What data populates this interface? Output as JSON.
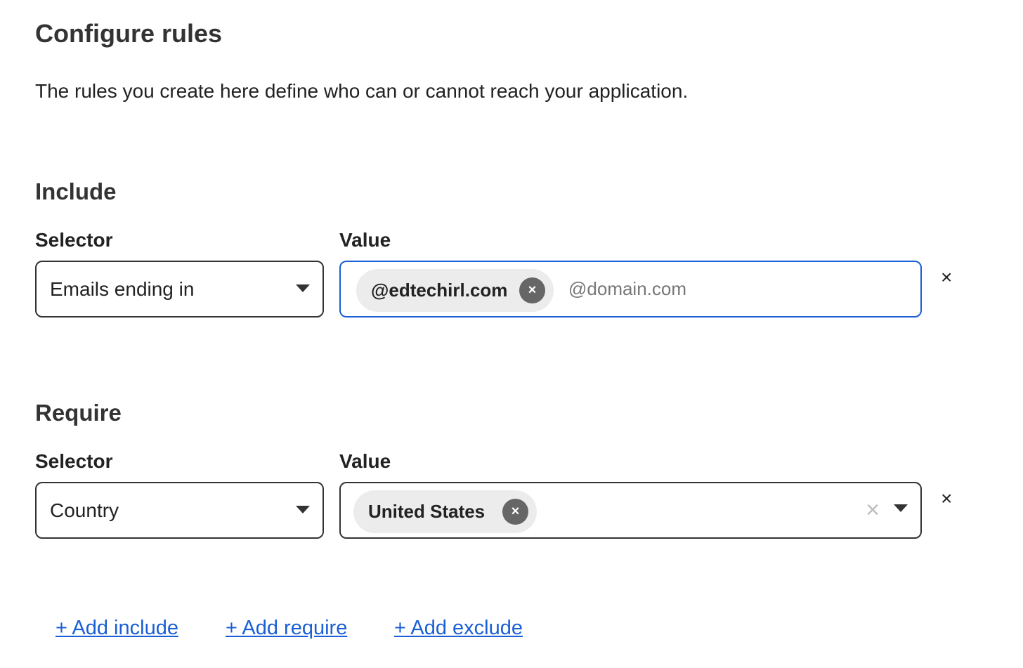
{
  "header": {
    "title": "Configure rules",
    "description": "The rules you create here define who can or cannot reach your application."
  },
  "include": {
    "section_title": "Include",
    "selector_label": "Selector",
    "value_label": "Value",
    "selector_value": "Emails ending in",
    "chips": [
      "@edtechirl.com"
    ],
    "input_placeholder": "@domain.com",
    "input_value": "",
    "chip_remove_icon": "×",
    "row_remove_icon": "×"
  },
  "require": {
    "section_title": "Require",
    "selector_label": "Selector",
    "value_label": "Value",
    "selector_value": "Country",
    "chips": [
      "United States"
    ],
    "chip_remove_icon": "×",
    "clear_icon": "×",
    "row_remove_icon": "×"
  },
  "actions": {
    "add_include": "+ Add include",
    "add_require": "+ Add require",
    "add_exclude": "+ Add exclude"
  },
  "colors": {
    "accent": "#1a5fd6",
    "text": "#222222",
    "chip_bg": "#ececec",
    "chip_x_bg": "#666666"
  }
}
